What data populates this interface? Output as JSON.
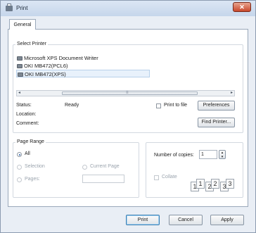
{
  "window": {
    "title": "Print",
    "close_glyph": "✕"
  },
  "tabs": [
    {
      "label": "General"
    }
  ],
  "select_printer": {
    "label": "Select Printer",
    "printers": [
      {
        "name": "Microsoft XPS Document Writer",
        "selected": false
      },
      {
        "name": "OKI MB472(PCL6)",
        "selected": false
      },
      {
        "name": "OKI MB472(XPS)",
        "selected": true
      }
    ],
    "scrollbar": {
      "left_arrow": "◂",
      "right_arrow": "▸",
      "grip": "≡"
    },
    "status_label": "Status:",
    "status_value": "Ready",
    "location_label": "Location:",
    "comment_label": "Comment:",
    "print_to_file_label": "Print to file",
    "preferences_label": "Preferences",
    "find_printer_label": "Find Printer..."
  },
  "page_range": {
    "label": "Page Range",
    "all_label": "All",
    "selection_label": "Selection",
    "current_page_label": "Current Page",
    "pages_label": "Pages:",
    "pages_value": ""
  },
  "copies": {
    "number_label": "Number of copies:",
    "number_value": "1",
    "collate_label": "Collate",
    "collate_pages": [
      "1",
      "1",
      "2",
      "2",
      "3",
      "3"
    ]
  },
  "footer": {
    "print_label": "Print",
    "cancel_label": "Cancel",
    "apply_label": "Apply"
  },
  "colors": {
    "accent": "#3c7fb1",
    "close": "#c9482c",
    "window_bg": "#e9eef5"
  },
  "icons": [
    "printer-icon",
    "close-icon",
    "chevron-left-icon",
    "chevron-right-icon",
    "spinner-icon"
  ]
}
